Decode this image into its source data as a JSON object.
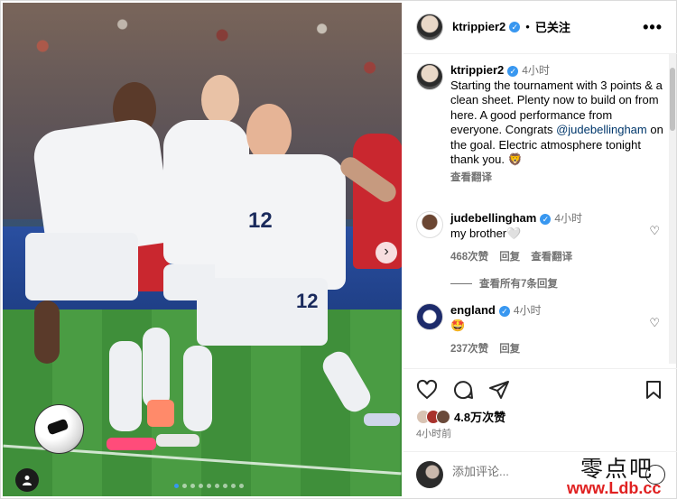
{
  "post": {
    "author": "ktrippier2",
    "follow_state": "已关注",
    "more_icon": "more-icon",
    "caption": {
      "time": "4小时",
      "text_before_mention": "Starting the tournament with 3 points & a clean sheet. Plenty now to build on from here. A good performance from everyone. Congrats ",
      "mention": "@judebellingham",
      "text_after_mention": " on the goal. Electric atmosphere tonight thank you. 🦁",
      "translate": "查看翻译"
    },
    "comments": [
      {
        "author": "judebellingham",
        "time": "4小时",
        "text": "my brother🤍",
        "likes": "468次赞",
        "reply": "回复",
        "translate": "查看翻译"
      },
      {
        "author": "england",
        "time": "4小时",
        "text": "🤩",
        "likes": "237次赞",
        "reply": "回复"
      }
    ],
    "view_replies": "查看所有7条回复",
    "likes": "4.8万次赞",
    "posted": "4小时前",
    "add_comment_placeholder": "添加评论..."
  },
  "photo": {
    "shirt_numbers": [
      "12",
      "12"
    ],
    "carousel": {
      "count": 9,
      "active": 0
    }
  },
  "watermark": {
    "cn": "零点吧",
    "url": "www.Ldb.cc"
  },
  "colors": {
    "verified": "#3897f0",
    "link": "#00376b",
    "muted": "#737373",
    "watermark_red": "#e02020"
  }
}
